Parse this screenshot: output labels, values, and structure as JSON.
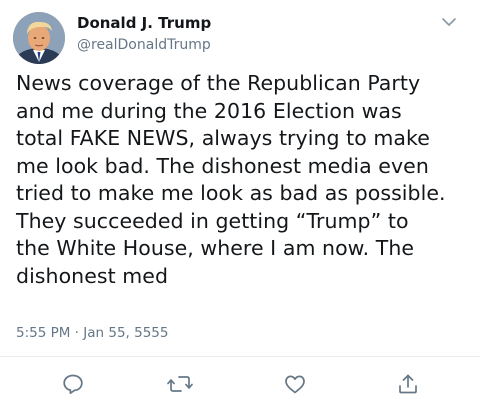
{
  "tweet": {
    "author": {
      "display_name": "Donald J. Trump",
      "handle": "@realDonaldTrump",
      "avatar_icon": "profile-avatar"
    },
    "text": "News coverage of the Republican Party\nand me during the 2016 Election was\ntotal FAKE NEWS, always trying to make\nme look bad. The dishonest media even\ntried to make me look as bad as possible.\nThey succeeded in getting “Trump” to\nthe White House, where I am now. The\ndishonest med",
    "timestamp": "5:55 PM · Jan 55, 5555",
    "menu_icon": "chevron-down-icon",
    "actions": [
      {
        "name": "reply",
        "icon": "reply-icon"
      },
      {
        "name": "retweet",
        "icon": "retweet-icon"
      },
      {
        "name": "like",
        "icon": "heart-icon"
      },
      {
        "name": "share",
        "icon": "share-icon"
      }
    ]
  },
  "colors": {
    "text_primary": "#14171a",
    "text_secondary": "#657786",
    "icon_gray": "#657786",
    "divider": "#e6ecf0",
    "background": "#ffffff"
  }
}
